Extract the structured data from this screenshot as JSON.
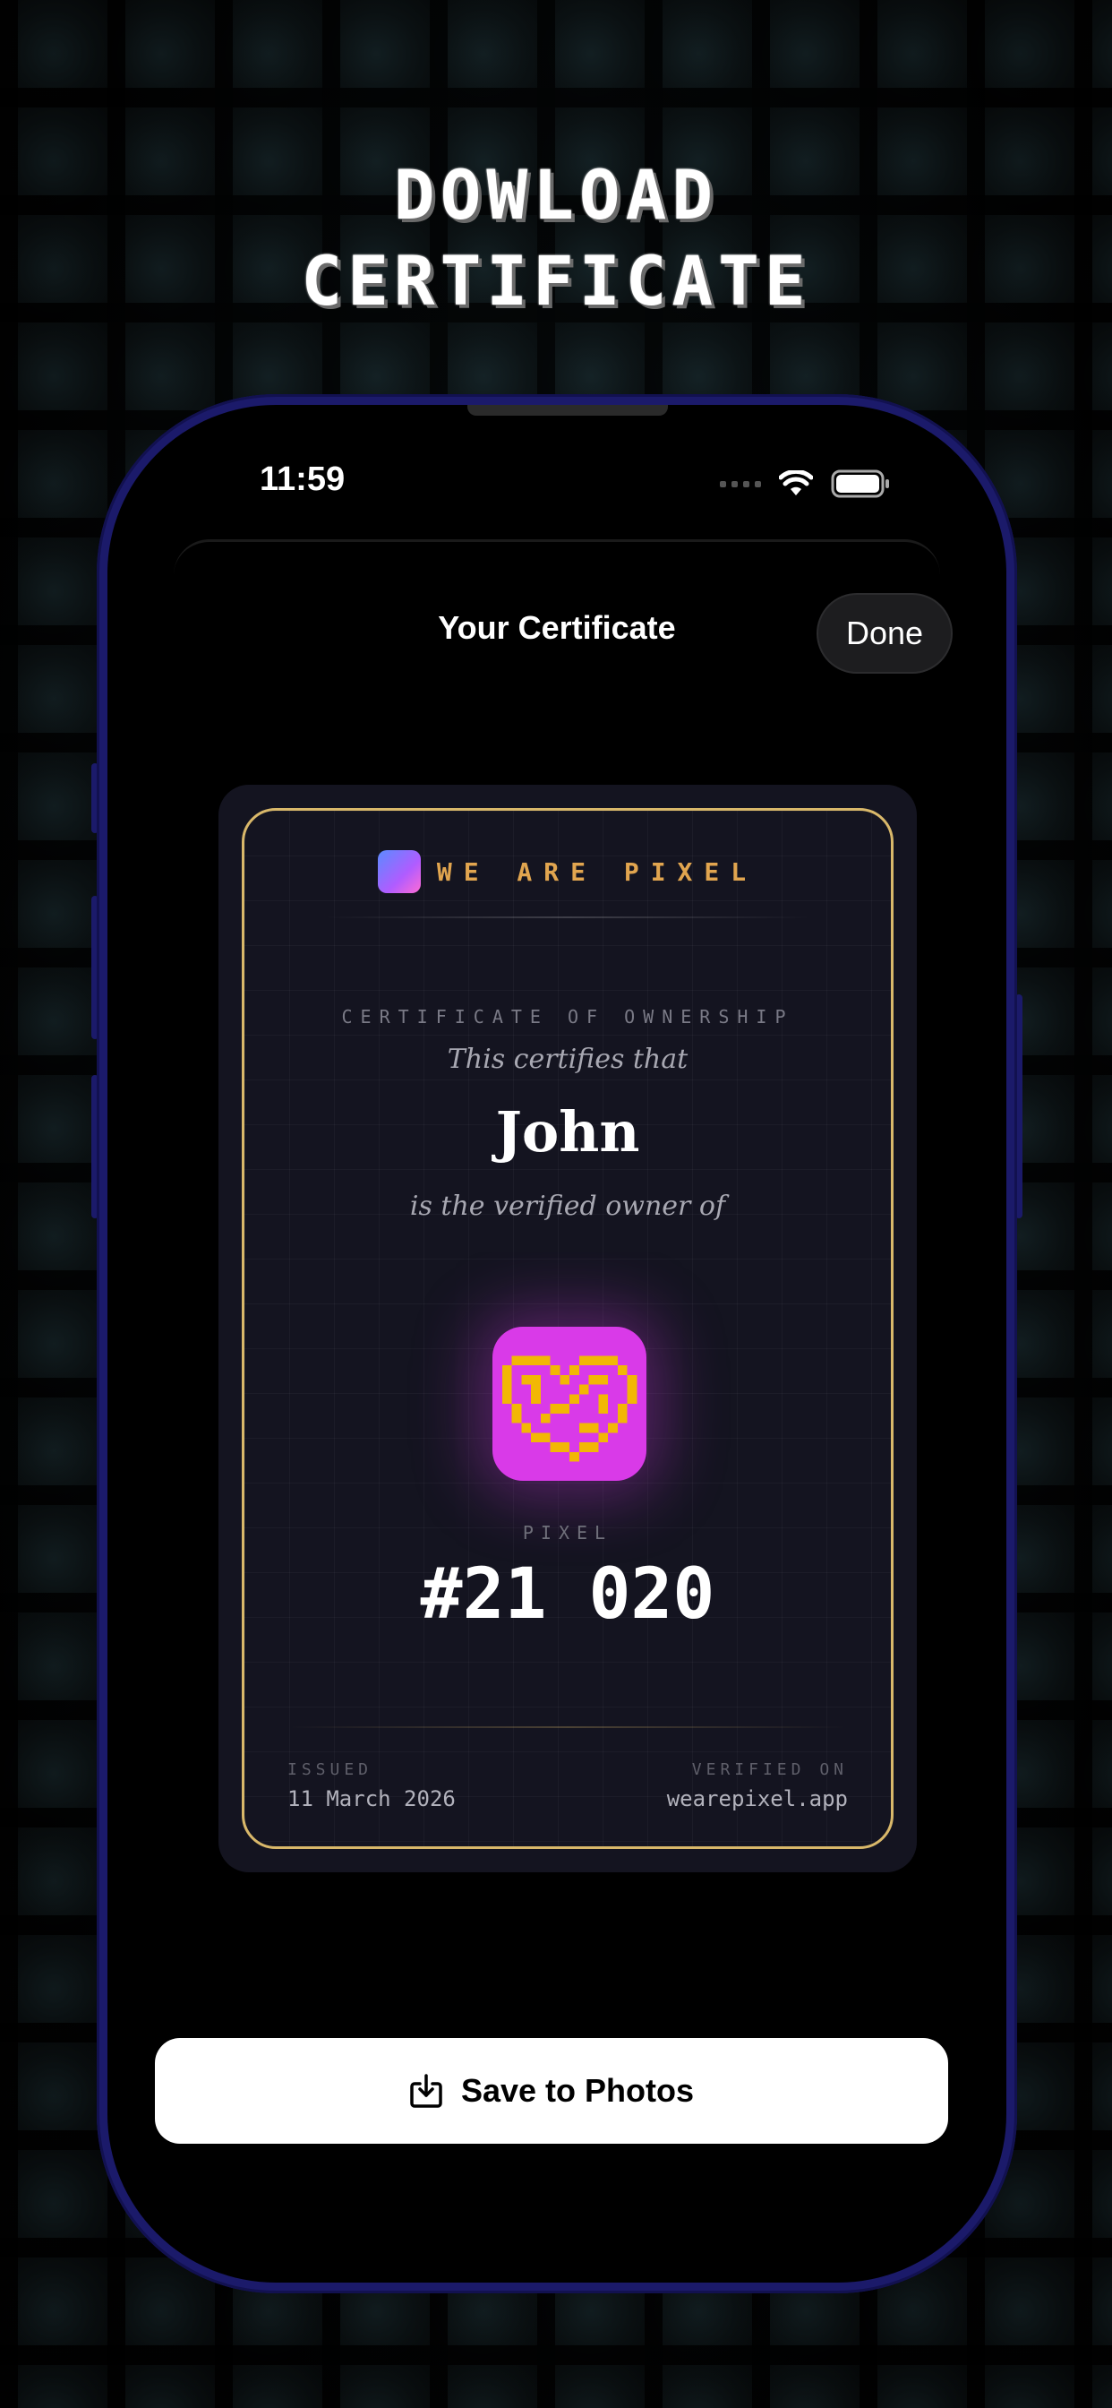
{
  "headline": {
    "line1": "DOWLOAD",
    "line2": "CERTIFICATE"
  },
  "status_bar": {
    "time": "11:59"
  },
  "nav": {
    "title": "Your Certificate",
    "done_label": "Done"
  },
  "certificate": {
    "brand_name": "WE ARE PIXEL",
    "type": "CERTIFICATE OF OWNERSHIP",
    "certifies_text": "This certifies that",
    "owner_name": "John",
    "verified_owner_text": "is the verified owner of",
    "pixel_label": "PIXEL",
    "pixel_number": "#21 020",
    "issued_label": "ISSUED",
    "issued_date": "11 March 2026",
    "verified_label": "VERIFIED ON",
    "verified_site": "wearepixel.app"
  },
  "actions": {
    "save_label": "Save to Photos"
  },
  "colors": {
    "accent_gold": "#d9b86a",
    "brand_orange": "#e1a54f",
    "pixel_magenta": "#d93ae8",
    "pixel_yellow": "#f2b705",
    "phone_frame": "#1b1a6a"
  },
  "icons": {
    "wifi": "wifi-icon",
    "battery": "battery-icon",
    "save": "download-to-photos-icon",
    "pixel_art": "pixel-heart-icon"
  }
}
